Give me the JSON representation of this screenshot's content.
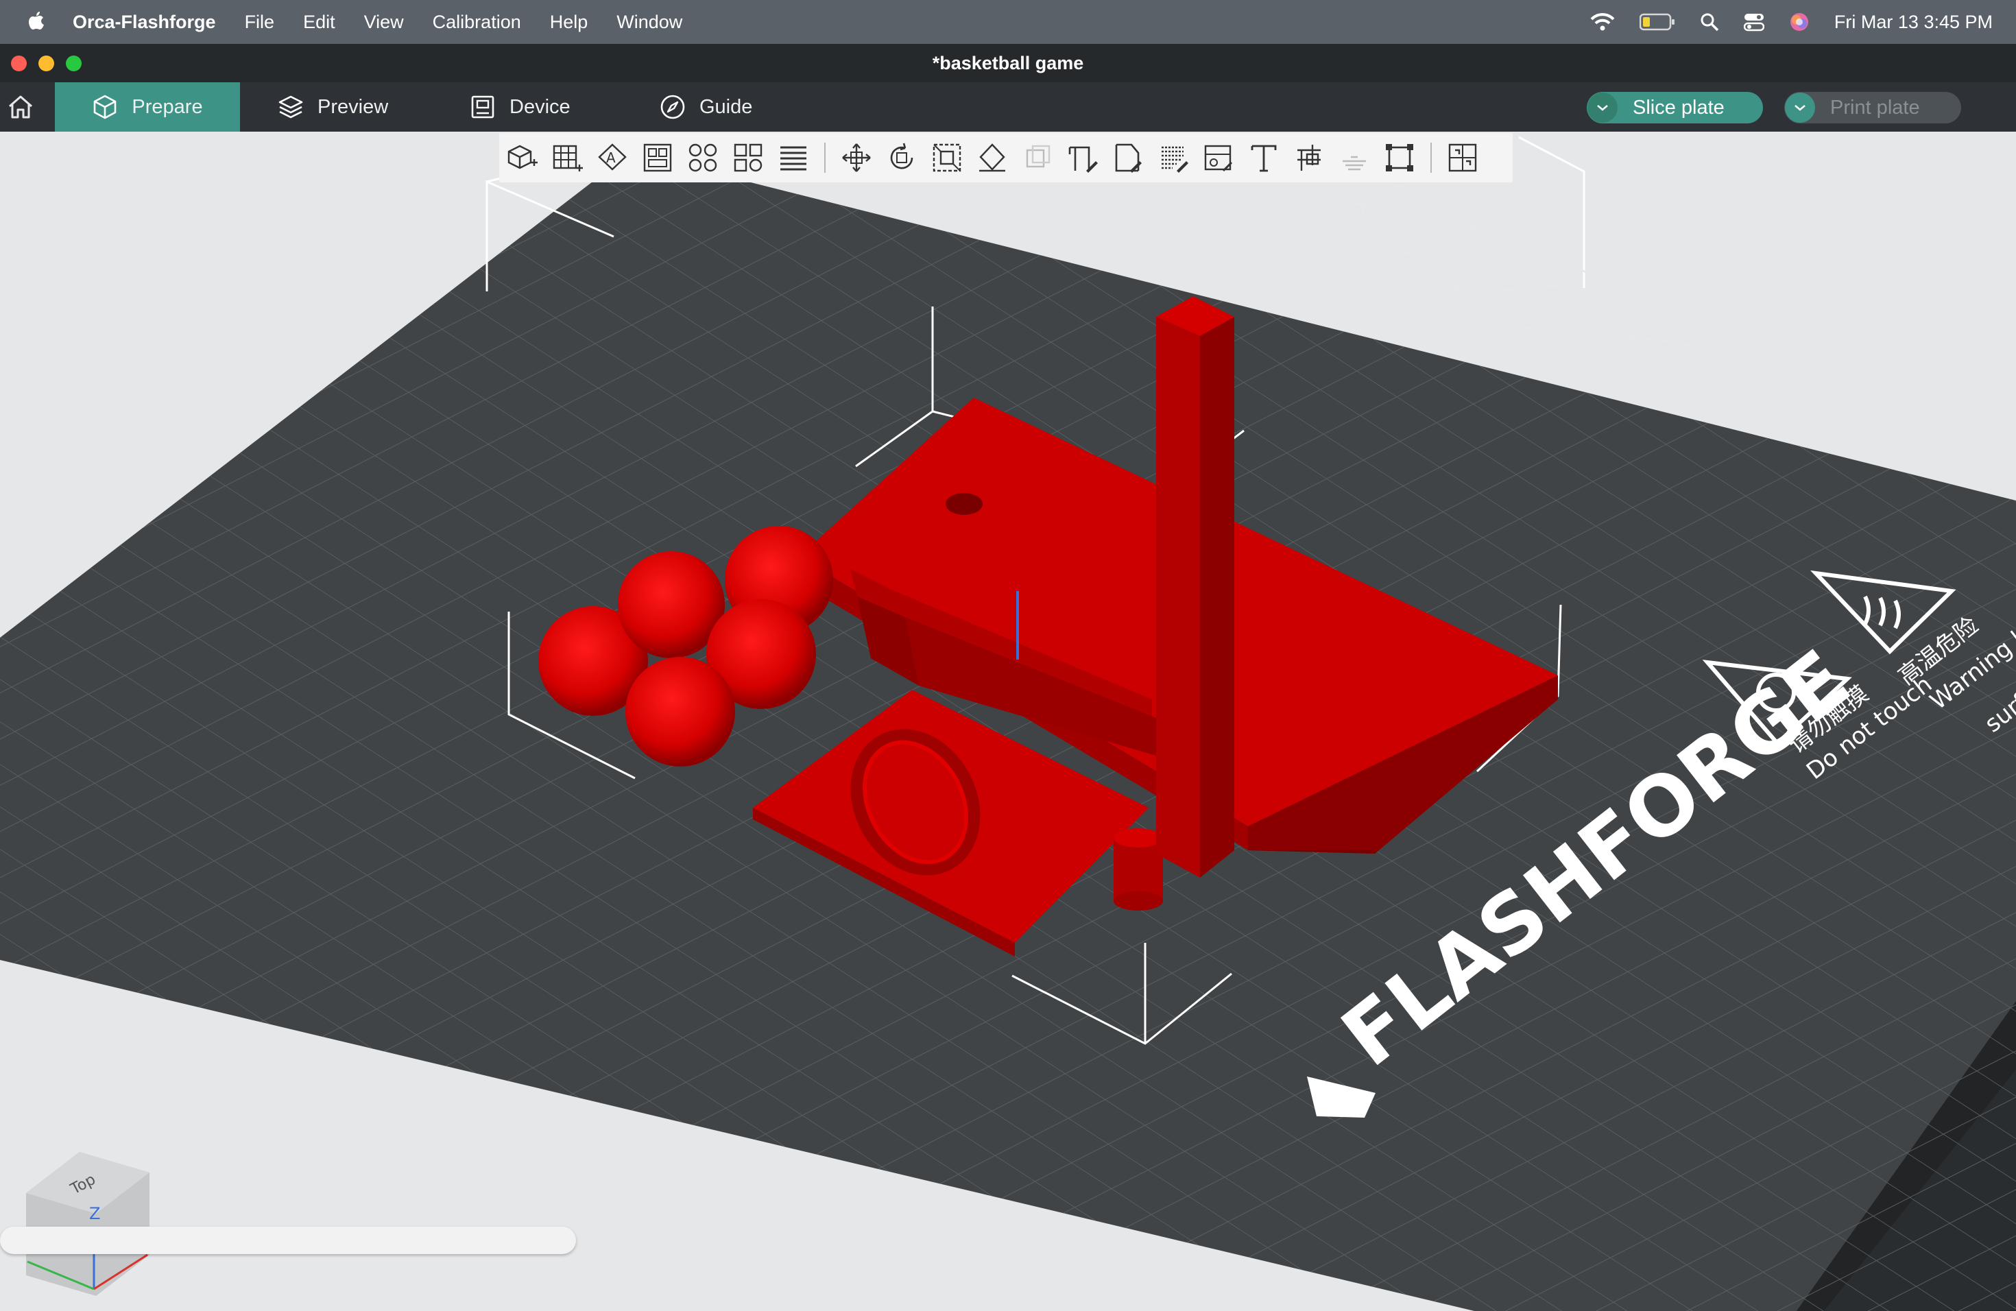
{
  "menubar": {
    "app_name": "Orca-Flashforge",
    "items": [
      "File",
      "Edit",
      "View",
      "Calibration",
      "Help",
      "Window"
    ],
    "clock": "Fri Mar 13  3:45 PM",
    "status_icons": [
      "wifi-icon",
      "battery-icon",
      "spotlight-search-icon",
      "control-center-icon",
      "siri-icon"
    ]
  },
  "window": {
    "title": "*basketball game"
  },
  "tabs": [
    {
      "label": "Prepare",
      "icon": "cube-icon",
      "active": true
    },
    {
      "label": "Preview",
      "icon": "layers-icon",
      "active": false
    },
    {
      "label": "Device",
      "icon": "device-icon",
      "active": false
    },
    {
      "label": "Guide",
      "icon": "compass-icon",
      "active": false
    }
  ],
  "actions": {
    "slice_label": "Slice plate",
    "print_label": "Print plate",
    "slice_color": "#3d9486",
    "print_enabled": false
  },
  "object_toolbar": {
    "tools": [
      "add-object-icon",
      "add-plate-icon",
      "auto-orient-icon",
      "arrange-icon",
      "split-objects-icon",
      "split-parts-icon",
      "variable-layer-height-icon",
      "move-icon",
      "rotate-icon",
      "scale-icon",
      "lay-on-face-icon",
      "cut-icon",
      "support-paint-icon",
      "seam-paint-icon",
      "fuzzy-skin-icon",
      "measure-icon",
      "text-icon",
      "assembly-icon",
      "mesh-boolean-icon",
      "fit-icon",
      "split-to-plates-icon"
    ]
  },
  "bed": {
    "brand": "FLASHFORGE",
    "warning_hot_cn": "高温危险",
    "warning_hot": "Warning hot",
    "warning_hot_2": "surface",
    "warning_touch_cn": "请勿触摸",
    "warning_touch": "Do not touch",
    "model_color": "#cc0000"
  },
  "view_cube": {
    "face_label": "Top",
    "axis_label": "Z"
  },
  "progress": {
    "fraction": 0.0
  }
}
